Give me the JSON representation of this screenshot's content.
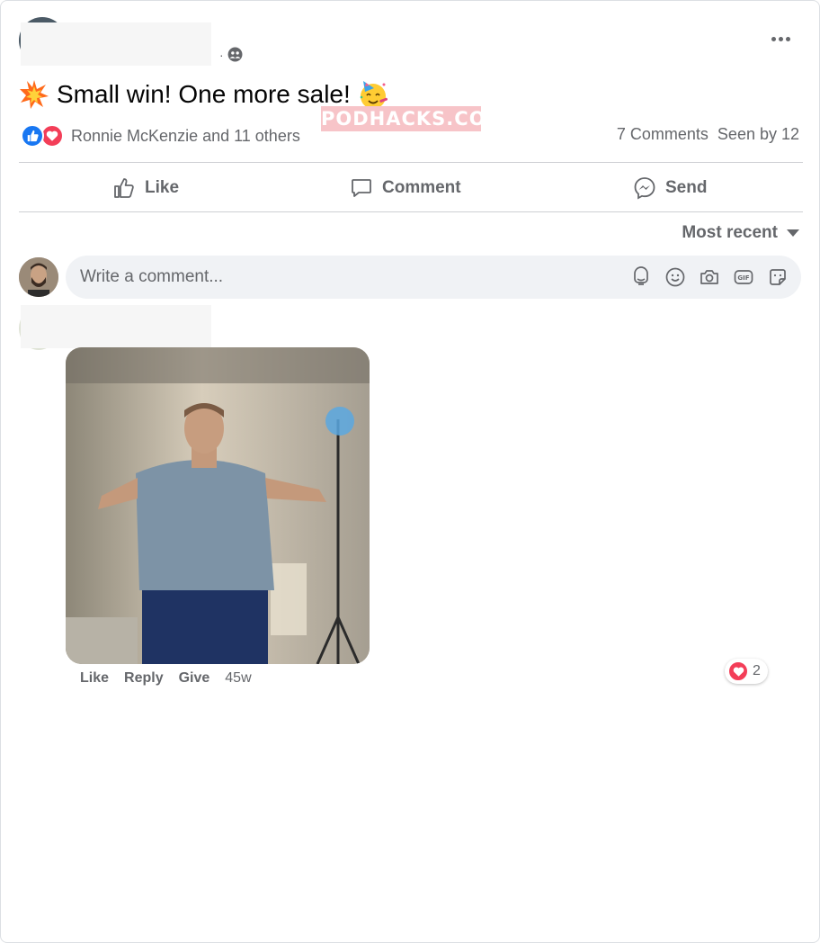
{
  "post": {
    "privacy_separator": "·",
    "privacy_icon": "friends-globe-icon",
    "text": "Small win! One more sale!",
    "leading_emoji": "collision-icon",
    "trailing_emoji": "partying-face-icon"
  },
  "watermark": {
    "text": "PODHACKS.CO"
  },
  "reactions": {
    "types": [
      "like",
      "love"
    ],
    "names": "Ronnie McKenzie and 11 others",
    "comments": "7 Comments",
    "seen": "Seen by 12"
  },
  "actions": {
    "like": "Like",
    "comment": "Comment",
    "send": "Send"
  },
  "sort": {
    "label": "Most recent"
  },
  "composer": {
    "placeholder": "Write a comment...",
    "icons": [
      "avatar-sticker-icon",
      "emoji-icon",
      "camera-icon",
      "gif-icon",
      "sticker-icon"
    ]
  },
  "comment": {
    "media": "gif-man-dancing",
    "actions": [
      "Like",
      "Reply",
      "Give"
    ],
    "time": "45w",
    "reaction_count": "2"
  },
  "colors": {
    "accent_blue": "#1877f2",
    "love_red": "#f33e58",
    "secondary_text": "#65676b",
    "composer_bg": "#f0f2f5"
  }
}
